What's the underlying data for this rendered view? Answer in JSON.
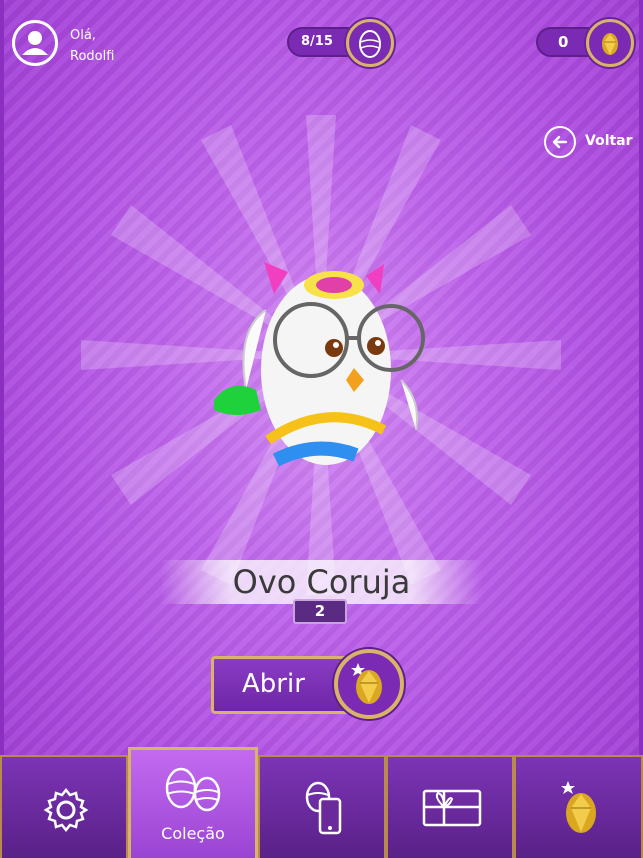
{
  "header": {
    "greeting": "Olá,",
    "username": "Rodolfi",
    "collection_count": "8/15",
    "gold_count": "0",
    "back_label": "Voltar"
  },
  "egg": {
    "name": "Ovo Coruja",
    "quantity": "2"
  },
  "actions": {
    "open_label": "Abrir"
  },
  "nav": {
    "items": [
      {
        "icon": "gear-icon",
        "label": ""
      },
      {
        "icon": "eggs-collection-icon",
        "label": "Coleção"
      },
      {
        "icon": "egg-phone-icon",
        "label": ""
      },
      {
        "icon": "gift-icon",
        "label": ""
      },
      {
        "icon": "golden-egg-icon",
        "label": ""
      }
    ],
    "active_index": 1
  },
  "colors": {
    "background": "#b04fe0",
    "accent_gold": "#d8b36a",
    "dark_purple": "#5b2a82"
  }
}
